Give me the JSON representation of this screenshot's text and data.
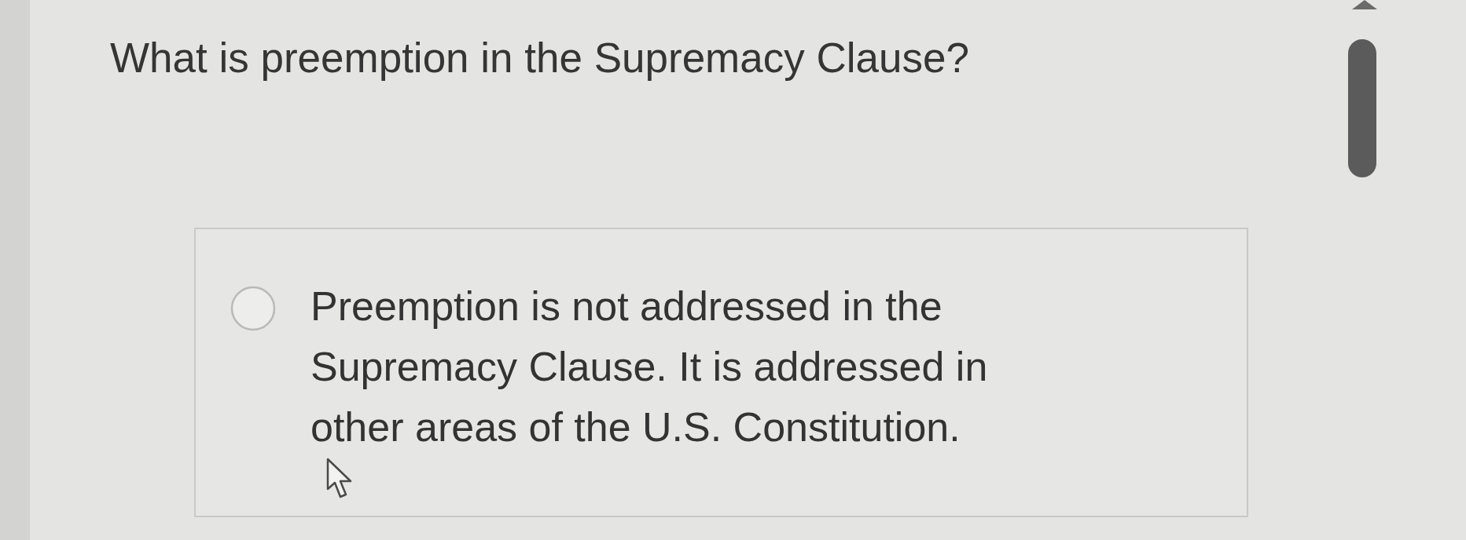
{
  "question": {
    "text": "What is preemption in the Supremacy Clause?"
  },
  "options": [
    {
      "text": "Preemption is not addressed in the Supremacy Clause. It is addressed in other areas of the U.S. Constitution.",
      "selected": false
    }
  ]
}
